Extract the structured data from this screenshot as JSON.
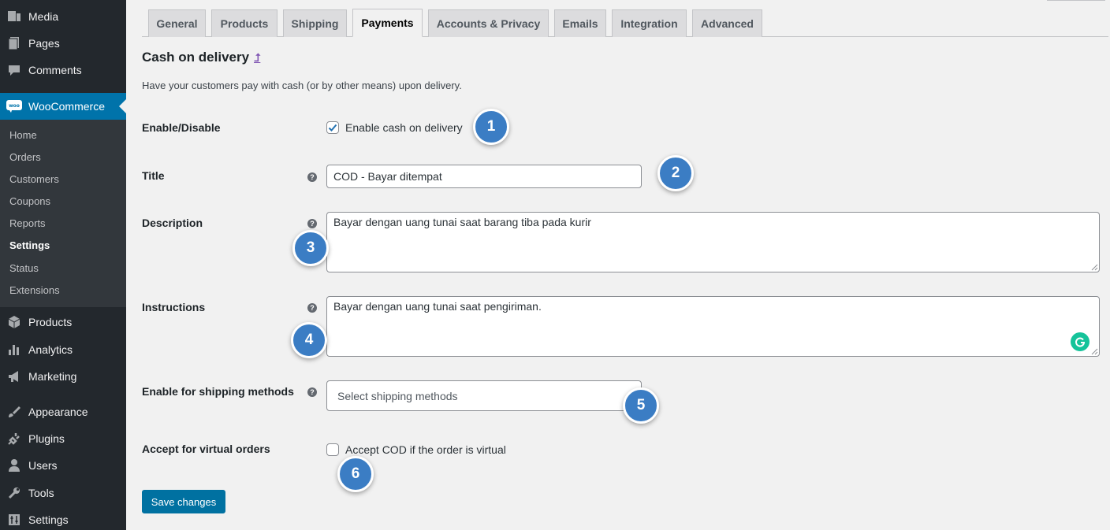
{
  "sidebar": {
    "items_top": [
      {
        "label": "Media",
        "icon": "media-icon"
      },
      {
        "label": "Pages",
        "icon": "pages-icon"
      },
      {
        "label": "Comments",
        "icon": "comments-icon"
      }
    ],
    "woocommerce": {
      "label": "WooCommerce",
      "icon": "woocommerce-icon"
    },
    "submenu": [
      "Home",
      "Orders",
      "Customers",
      "Coupons",
      "Reports",
      "Settings",
      "Status",
      "Extensions"
    ],
    "current_submenu": "Settings",
    "items_bottom": [
      {
        "label": "Products",
        "icon": "products-icon"
      },
      {
        "label": "Analytics",
        "icon": "analytics-icon"
      },
      {
        "label": "Marketing",
        "icon": "marketing-icon"
      },
      {
        "label": "Appearance",
        "icon": "appearance-icon"
      },
      {
        "label": "Plugins",
        "icon": "plugins-icon"
      },
      {
        "label": "Users",
        "icon": "users-icon"
      },
      {
        "label": "Tools",
        "icon": "tools-icon"
      },
      {
        "label": "Settings",
        "icon": "settings-icon"
      }
    ]
  },
  "tabs": [
    "General",
    "Products",
    "Shipping",
    "Payments",
    "Accounts & Privacy",
    "Emails",
    "Integration",
    "Advanced"
  ],
  "active_tab": "Payments",
  "page": {
    "heading": "Cash on delivery",
    "up_link": "⮥",
    "description": "Have your customers pay with cash (or by other means) upon delivery."
  },
  "fields": {
    "enable": {
      "label": "Enable/Disable",
      "checkbox_label": "Enable cash on delivery",
      "checked": true
    },
    "title": {
      "label": "Title",
      "value": "COD - Bayar ditempat"
    },
    "description": {
      "label": "Description",
      "value": "Bayar dengan uang tunai saat barang tiba pada kurir"
    },
    "instructions": {
      "label": "Instructions",
      "value": "Bayar dengan uang tunai saat pengiriman."
    },
    "shipping_methods": {
      "label": "Enable for shipping methods",
      "placeholder": "Select shipping methods"
    },
    "virtual": {
      "label": "Accept for virtual orders",
      "checkbox_label": "Accept COD if the order is virtual",
      "checked": false
    }
  },
  "help_symbol": "?",
  "save_button": "Save changes",
  "badges": [
    "1",
    "2",
    "3",
    "4",
    "5",
    "6"
  ],
  "colors": {
    "sidebar": "#23282d",
    "active_menu": "#0073aa",
    "button": "#0071a1",
    "badge": "#3b7dc4"
  }
}
